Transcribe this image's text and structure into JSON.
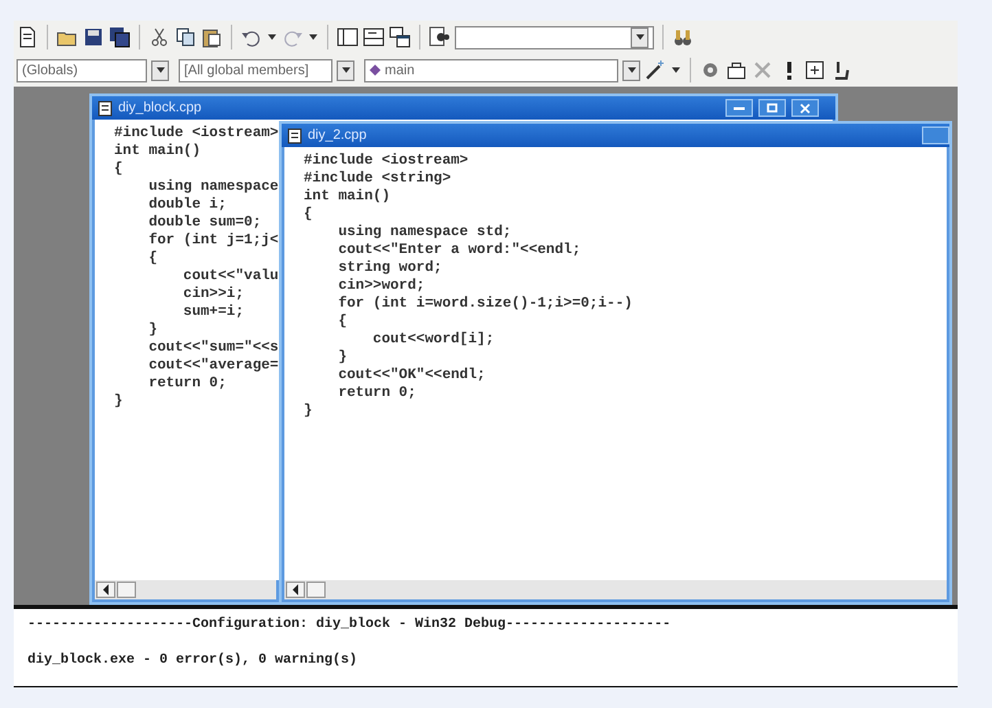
{
  "toolbar_combos": [
    {
      "value": "(Globals)"
    },
    {
      "value": "[All global members]"
    },
    {
      "value": "main",
      "kind": "function"
    }
  ],
  "windows": [
    {
      "title": "diy_block.cpp",
      "lines": [
        "#include <iostream>",
        "int main()",
        "{",
        "    using namespace",
        "    double i;",
        "    double sum=0;",
        "    for (int j=1;j<",
        "    {",
        "        cout<<\"valu",
        "        cin>>i;",
        "        sum+=i;",
        "    }",
        "    cout<<\"sum=\"<<s",
        "    cout<<\"average=",
        "    return 0;",
        "}"
      ]
    },
    {
      "title": "diy_2.cpp",
      "lines": [
        "#include <iostream>",
        "#include <string>",
        "int main()",
        "{",
        "    using namespace std;",
        "    cout<<\"Enter a word:\"<<endl;",
        "    string word;",
        "    cin>>word;",
        "    for (int i=word.size()-1;i>=0;i--)",
        "    {",
        "        cout<<word[i];",
        "    }",
        "    cout<<\"OK\"<<endl;",
        "    return 0;",
        "}"
      ]
    }
  ],
  "output": {
    "lines": [
      "--------------------Configuration: diy_block - Win32 Debug--------------------",
      "diy_block.exe - 0 error(s), 0 warning(s)"
    ]
  }
}
